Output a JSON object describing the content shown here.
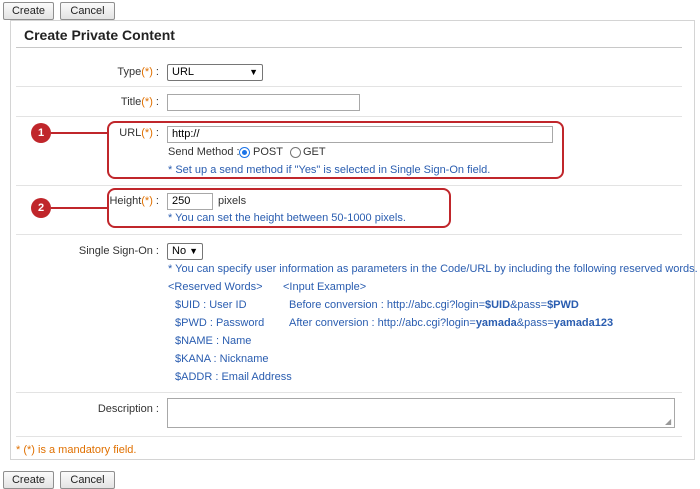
{
  "toolbar": {
    "create_label": "Create",
    "cancel_label": "Cancel"
  },
  "page_title": "Create Private Content",
  "form": {
    "required_mark": "(*)",
    "type": {
      "label": "Type",
      "value": "URL"
    },
    "title": {
      "label": "Title",
      "value": ""
    },
    "url": {
      "label": "URL",
      "value": "http://",
      "send_method_label": "Send Method :",
      "options": [
        "POST",
        "GET"
      ],
      "selected": "POST",
      "note": "* Set up a send method if \"Yes\" is selected in Single Sign-On field."
    },
    "height": {
      "label": "Height",
      "value": "250",
      "unit": "pixels",
      "note": "* You can set the height between 50-1000 pixels."
    },
    "sso": {
      "label": "Single Sign-On",
      "value": "No",
      "note": "* You can specify user information as parameters in the Code/URL by including the following reserved words.",
      "reserved_header": "<Reserved Words>",
      "example_header": "<Input Example>",
      "reserved_words": [
        "$UID : User ID",
        "$PWD : Password",
        "$NAME : Name",
        "$KANA : Nickname",
        "$ADDR : Email Address"
      ],
      "before_label": "Before conversion :",
      "before_url": "http://abc.cgi?login=",
      "before_uid": "$UID",
      "before_mid": "&pass=",
      "before_pwd": "$PWD",
      "after_label": "After conversion :",
      "after_url": "http://abc.cgi?login=",
      "after_user": "yamada",
      "after_mid": "&pass=",
      "after_pass": "yamada123"
    },
    "description": {
      "label": "Description",
      "value": ""
    },
    "mandatory_note": "*  (*) is a mandatory field."
  },
  "callouts": [
    "1",
    "2"
  ],
  "colors": {
    "accent_red": "#c0262b",
    "required_orange": "#e07000",
    "note_blue": "#2a5db0",
    "radio_blue": "#1a73e8"
  }
}
